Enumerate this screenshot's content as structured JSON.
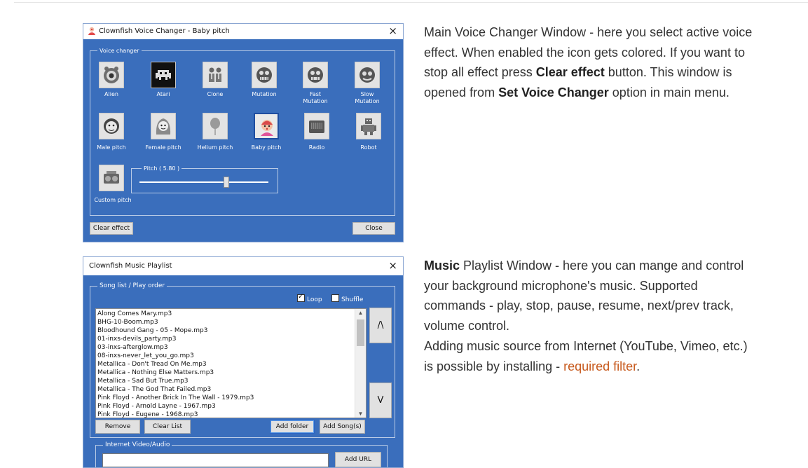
{
  "window1": {
    "title": "Clownfish Voice Changer - Baby pitch",
    "close_glyph": "×",
    "group_label": "Voice changer",
    "effects": [
      {
        "label": "Alien",
        "icon": "alien-icon",
        "selected": false
      },
      {
        "label": "Atari",
        "icon": "atari-invader-icon",
        "selected": false
      },
      {
        "label": "Clone",
        "icon": "clone-icon",
        "selected": false
      },
      {
        "label": "Mutation",
        "icon": "mutation-icon",
        "selected": false
      },
      {
        "label": "Fast\nMutation",
        "icon": "fast-mutation-icon",
        "selected": false
      },
      {
        "label": "Slow\nMutation",
        "icon": "slow-mutation-icon",
        "selected": false
      },
      {
        "label": "Male pitch",
        "icon": "male-face-icon",
        "selected": false
      },
      {
        "label": "Female pitch",
        "icon": "female-face-icon",
        "selected": false
      },
      {
        "label": "Helium pitch",
        "icon": "balloon-icon",
        "selected": false
      },
      {
        "label": "Baby pitch",
        "icon": "baby-icon",
        "selected": true
      },
      {
        "label": "Radio",
        "icon": "radio-icon",
        "selected": false
      },
      {
        "label": "Robot",
        "icon": "robot-icon",
        "selected": false
      },
      {
        "label": "Custom pitch",
        "icon": "custom-pitch-icon",
        "selected": false
      }
    ],
    "pitch_label": "Pitch ( 5.80 )",
    "pitch_fraction": 0.68,
    "clear_button": "Clear effect",
    "close_button": "Close"
  },
  "desc1": {
    "part1": "Main Voice Changer Window - here you select active voice effect. When enabled the icon gets colored. If you want to stop all effect press ",
    "bold1": "Clear effect",
    "part2": " button. This window is opened from ",
    "bold2": "Set Voice Changer",
    "part3": " option in main menu."
  },
  "window2": {
    "title": "Clownfish Music Playlist",
    "close_glyph": "×",
    "group_label": "Song list / Play order",
    "loop_label": "Loop",
    "loop_checked": true,
    "shuffle_label": "Shuffle",
    "shuffle_checked": false,
    "songs": [
      "Along Comes Mary.mp3",
      "BHG-10-Boom.mp3",
      "Bloodhound Gang - 05 - Mope.mp3",
      "01-inxs-devils_party.mp3",
      "03-inxs-afterglow.mp3",
      "08-inxs-never_let_you_go.mp3",
      "Metallica - Don't Tread On Me.mp3",
      "Metallica - Nothing Else Matters.mp3",
      "Metallica - Sad But True.mp3",
      "Metallica - The God That Failed.mp3",
      "Pink Floyd - Another Brick In The Wall - 1979.mp3",
      "Pink Floyd - Arnold Layne - 1967.mp3",
      "Pink Floyd - Eugene - 1968.mp3"
    ],
    "up_button": "/\\",
    "down_button": "V",
    "remove_button": "Remove",
    "clear_list_button": "Clear List",
    "add_folder_button": "Add folder",
    "add_songs_button": "Add Song(s)",
    "internet_group_label": "Internet Video/Audio",
    "add_url_button": "Add URL"
  },
  "desc2": {
    "bold1": "Music",
    "part1": " Playlist Window - here you can mange and control your background microphone's music. Supported commands - play, stop, pause, resume, next/prev track, volume control.",
    "part2": "Adding music source from Internet (YouTube, Vimeo, etc.) is possible by installing - ",
    "link": "required filter",
    "part3": "."
  },
  "colors": {
    "window_bg": "#3a6ebc",
    "link": "#c7591c",
    "text": "#333333"
  }
}
